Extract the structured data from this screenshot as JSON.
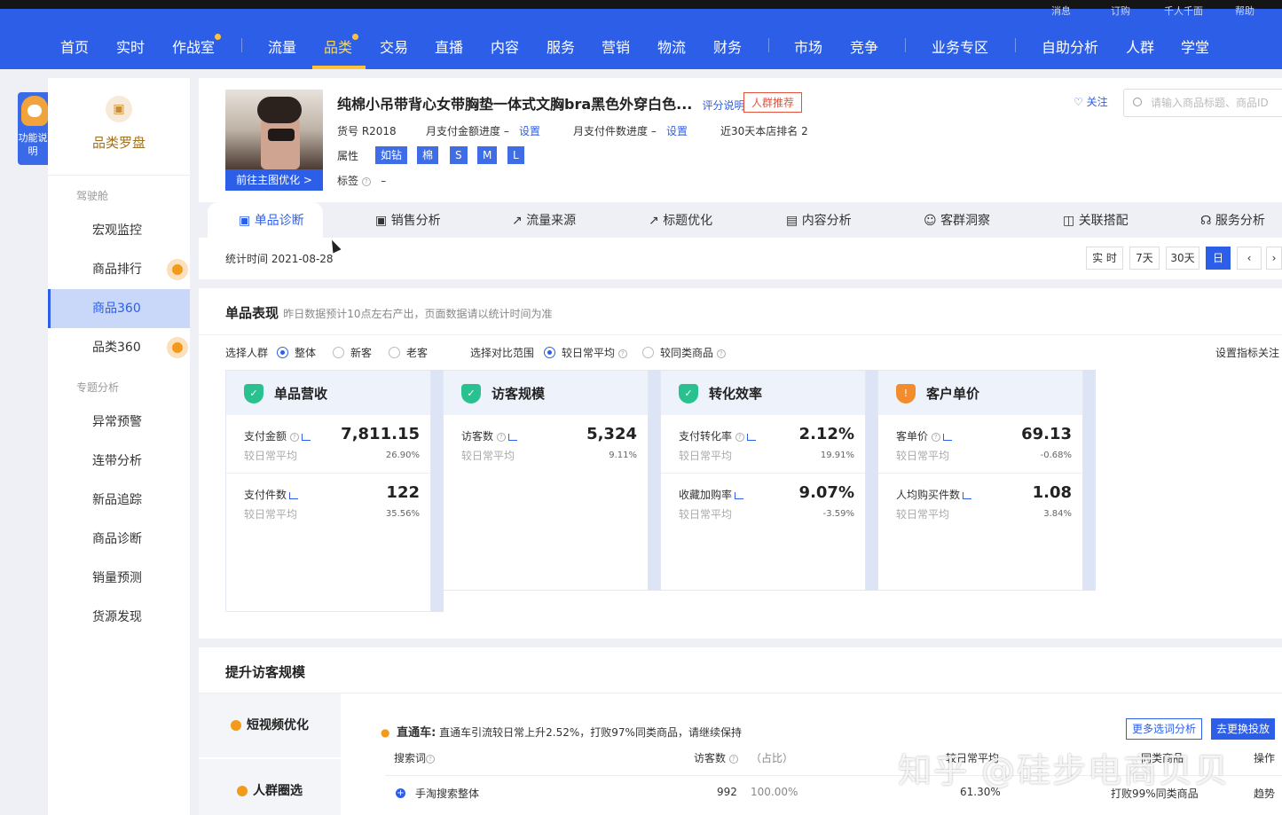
{
  "topnav": {
    "remnants": [
      "消息",
      "订购",
      "千人千面",
      "帮助"
    ],
    "items": [
      {
        "label": "首页"
      },
      {
        "label": "实时"
      },
      {
        "label": "作战室"
      },
      {
        "label": "流量"
      },
      {
        "label": "品类"
      },
      {
        "label": "交易"
      },
      {
        "label": "直播"
      },
      {
        "label": "内容"
      },
      {
        "label": "服务"
      },
      {
        "label": "营销"
      },
      {
        "label": "物流"
      },
      {
        "label": "财务"
      },
      {
        "label": "市场"
      },
      {
        "label": "竞争"
      },
      {
        "label": "业务专区"
      },
      {
        "label": "自助分析"
      },
      {
        "label": "人群"
      },
      {
        "label": "学堂"
      }
    ]
  },
  "helper": {
    "label": "功能说明"
  },
  "sidebar": {
    "title": "品类罗盘",
    "group1": "驾驶舱",
    "group2": "专题分析",
    "items": [
      {
        "label": "宏观监控"
      },
      {
        "label": "商品排行"
      },
      {
        "label": "商品360"
      },
      {
        "label": "品类360"
      },
      {
        "label": "异常预警"
      },
      {
        "label": "连带分析"
      },
      {
        "label": "新品追踪"
      },
      {
        "label": "商品诊断"
      },
      {
        "label": "销量预测"
      },
      {
        "label": "货源发现"
      }
    ]
  },
  "product": {
    "title": "纯棉小吊带背心女带胸垫一体式文胸bra黑色外穿白色...",
    "rating_link": "评分说明",
    "crowd_tag": "人群推荐",
    "follow": "关注",
    "search_placeholder": "请输入商品标题、商品ID",
    "optimize_btn": "前往主图优化 >",
    "sku": "货号 R2018",
    "pay_amount_progress": "月支付金额进度 –",
    "pay_count_progress": "月支付件数进度 –",
    "set_label": "设置",
    "rank": "近30天本店排名 2",
    "attr_label": "属性",
    "attrs": [
      "如钻",
      "棉",
      "S",
      "M",
      "L"
    ],
    "tag_label": "标签",
    "tag_value": "–"
  },
  "tabs": [
    {
      "label": "单品诊断"
    },
    {
      "label": "销售分析"
    },
    {
      "label": "流量来源"
    },
    {
      "label": "标题优化"
    },
    {
      "label": "内容分析"
    },
    {
      "label": "客群洞察"
    },
    {
      "label": "关联搭配"
    },
    {
      "label": "服务分析"
    }
  ],
  "stats_time": "统计时间 2021-08-28",
  "range_buttons": [
    "实 时",
    "7天",
    "30天",
    "日"
  ],
  "performance": {
    "title": "单品表现",
    "hint": "昨日数据预计10点左右产出，页面数据请以统计时间为准",
    "crowd_label": "选择人群",
    "crowd_options": [
      "整体",
      "新客",
      "老客"
    ],
    "compare_label": "选择对比范围",
    "compare_options": [
      "较日常平均",
      "较同类商品"
    ],
    "set_focus": "设置指标关注",
    "sub_label": "较日常平均",
    "cards": [
      {
        "name": "单品营收",
        "status": "ok",
        "metrics": [
          {
            "label": "支付金额",
            "value": "7,811.15",
            "pct": "26.90%"
          },
          {
            "label": "支付件数",
            "value": "122",
            "pct": "35.56%"
          }
        ]
      },
      {
        "name": "访客规模",
        "status": "ok",
        "metrics": [
          {
            "label": "访客数",
            "value": "5,324",
            "pct": "9.11%"
          }
        ]
      },
      {
        "name": "转化效率",
        "status": "ok",
        "metrics": [
          {
            "label": "支付转化率",
            "value": "2.12%",
            "pct": "19.91%"
          },
          {
            "label": "收藏加购率",
            "value": "9.07%",
            "pct": "-3.59%"
          }
        ]
      },
      {
        "name": "客户单价",
        "status": "warn",
        "metrics": [
          {
            "label": "客单价",
            "value": "69.13",
            "pct": "-0.68%"
          },
          {
            "label": "人均购买件数",
            "value": "1.08",
            "pct": "3.84%"
          }
        ]
      }
    ]
  },
  "visitors": {
    "title": "提升访客规模",
    "options": [
      "短视频优化",
      "人群圈选"
    ],
    "ztc_label": "直通车:",
    "ztc_text": "直通车引流较日常上升2.52%，打败97%同类商品，请继续保持",
    "btn_more": "更多选词分析",
    "btn_go": "去更换投放",
    "headers": [
      "搜索词",
      "访客数",
      "（占比）",
      "较日常平均",
      "同类商品",
      "操作"
    ],
    "row": {
      "term": "手淘搜索整体",
      "visitors": "992",
      "ratio": "100.00%",
      "change": "61.30%",
      "peer": "打败99%同类商品",
      "action": "趋势"
    }
  },
  "watermark": "知乎 @硅步电商贝贝"
}
